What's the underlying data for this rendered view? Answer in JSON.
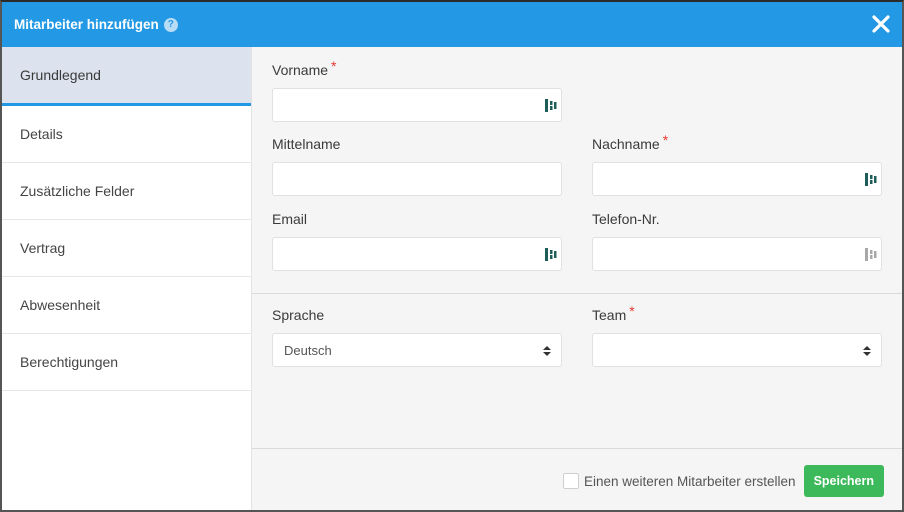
{
  "dialog": {
    "title": "Mitarbeiter hinzufügen",
    "help_icon_glyph": "?",
    "close_icon": "close-icon",
    "accent_color": "#2399e5"
  },
  "sidebar": {
    "items": [
      {
        "label": "Grundlegend",
        "active": true
      },
      {
        "label": "Details"
      },
      {
        "label": "Zusätzliche Felder"
      },
      {
        "label": "Vertrag"
      },
      {
        "label": "Abwesenheit"
      },
      {
        "label": "Berechtigungen"
      }
    ]
  },
  "form": {
    "required_marker": "*",
    "vorname": {
      "label": "Vorname",
      "value": "",
      "required": true
    },
    "mittelname": {
      "label": "Mittelname",
      "value": ""
    },
    "nachname": {
      "label": "Nachname",
      "value": "",
      "required": true
    },
    "email": {
      "label": "Email",
      "value": ""
    },
    "telefon": {
      "label": "Telefon-Nr.",
      "value": ""
    },
    "sprache": {
      "label": "Sprache",
      "selected": "Deutsch"
    },
    "team": {
      "label": "Team",
      "selected": "",
      "required": true
    }
  },
  "footer": {
    "checkbox_label": "Einen weiteren Mitarbeiter erstellen",
    "checkbox_checked": false,
    "save_label": "Speichern",
    "save_color": "#3cb95b"
  }
}
